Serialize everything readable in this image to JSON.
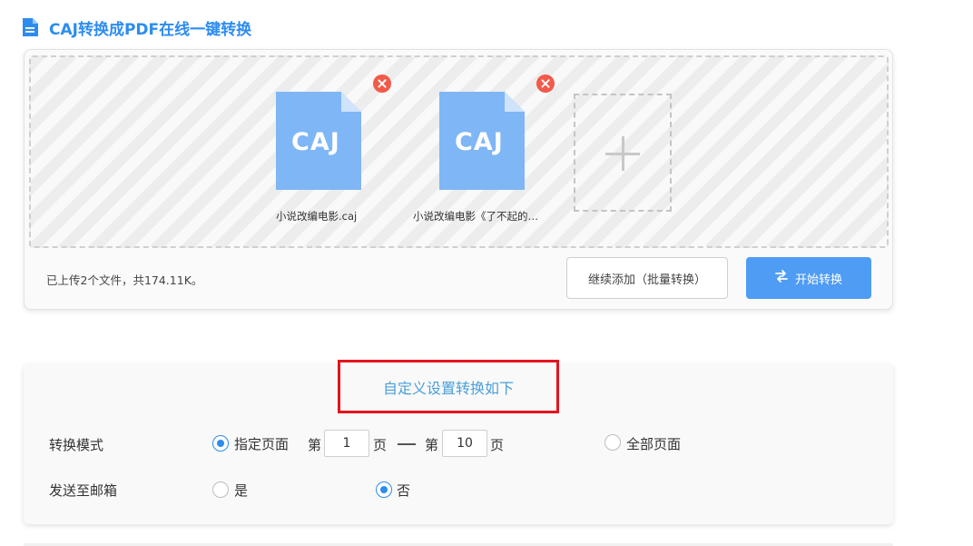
{
  "header": {
    "title": "CAJ转换成PDF在线一键转换",
    "icon": "document-icon",
    "accent_color": "#2d8cf0"
  },
  "upload": {
    "files": [
      {
        "type_label": "CAJ",
        "name": "小说改编电影.caj",
        "icon_color": "#7fb6f5"
      },
      {
        "type_label": "CAJ",
        "name": "小说改编电影《了不起的…",
        "icon_color": "#7fb6f5"
      }
    ],
    "status_text": "已上传2个文件，共174.11K。",
    "continue_button": "继续添加（批量转换）",
    "start_button": "开始转换",
    "start_button_color": "#4e9cf3"
  },
  "settings": {
    "title": "自定义设置转换如下",
    "mode": {
      "label": "转换模式",
      "option_pages": "指定页面",
      "page_prefix_from": "第",
      "page_from": "1",
      "page_unit_from": "页",
      "page_prefix_to": "第",
      "page_to": "10",
      "page_unit_to": "页",
      "option_all": "全部页面",
      "selected": "指定页面"
    },
    "email": {
      "label": "发送至邮箱",
      "option_yes": "是",
      "option_no": "否",
      "selected": "否"
    }
  }
}
